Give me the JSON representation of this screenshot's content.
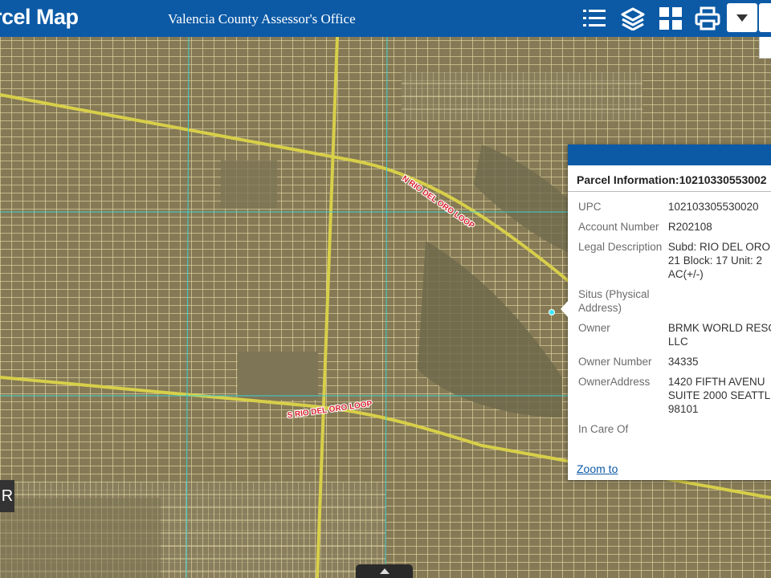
{
  "header": {
    "app_title": "rcel Map",
    "subtitle": "Valencia County Assessor's Office",
    "tools": [
      "legend-icon",
      "layers-icon",
      "basemap-gallery-icon",
      "print-icon",
      "dropdown-caret-icon"
    ]
  },
  "map": {
    "road_labels": [
      "N RIO DEL ORO LOOP",
      "S RIO DEL ORO LOOP"
    ],
    "colors": {
      "parcel_lines": "#e8dcaa",
      "roads": "#d8cf4a",
      "township_lines": "#3fd0d0",
      "road_label": "#d8212e"
    }
  },
  "popup": {
    "title": "Parcel Information:10210330553002",
    "fields": [
      {
        "label": "UPC",
        "value": "102103305530020"
      },
      {
        "label": "Account Number",
        "value": "R202108"
      },
      {
        "label": "Legal Description",
        "value": "Subd: RIO DEL ORO\n21 Block: 17 Unit: 2\nAC(+/-)"
      },
      {
        "label": "Situs (Physical Address)",
        "value": ""
      },
      {
        "label": "Owner",
        "value": "BRMK WORLD RESO\nLLC"
      },
      {
        "label": "Owner Number",
        "value": "34335"
      },
      {
        "label": "OwnerAddress",
        "value": "1420 FIFTH AVENU\nSUITE 2000 SEATTL\n98101"
      },
      {
        "label": "In Care Of",
        "value": ""
      }
    ],
    "zoom_label": "Zoom to"
  },
  "left_button": "R"
}
